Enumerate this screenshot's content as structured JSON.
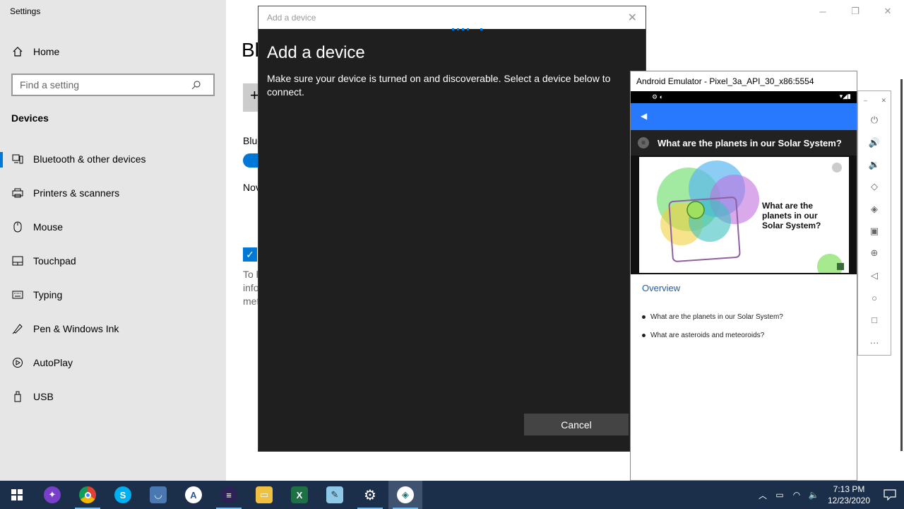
{
  "settings": {
    "window_title": "Settings",
    "home_label": "Home",
    "search_placeholder": "Find a setting",
    "section_header": "Devices",
    "nav": [
      {
        "label": "Bluetooth & other devices",
        "icon": "bluetooth-devices-icon"
      },
      {
        "label": "Printers & scanners",
        "icon": "printer-icon"
      },
      {
        "label": "Mouse",
        "icon": "mouse-icon"
      },
      {
        "label": "Touchpad",
        "icon": "touchpad-icon"
      },
      {
        "label": "Typing",
        "icon": "keyboard-icon"
      },
      {
        "label": "Pen & Windows Ink",
        "icon": "pen-icon"
      },
      {
        "label": "AutoPlay",
        "icon": "autoplay-icon"
      },
      {
        "label": "USB",
        "icon": "usb-icon"
      }
    ],
    "selected_index": 0,
    "background": {
      "page_title": "Bl",
      "add_symbol": "+",
      "bluetooth_label": "Blue",
      "now_label": "Nov",
      "para_lines": [
        "To h",
        "info",
        "met"
      ]
    }
  },
  "dialog": {
    "titlebar": "Add a device",
    "heading": "Add a device",
    "description": "Make sure your device is turned on and discoverable. Select a device below to connect.",
    "cancel_label": "Cancel"
  },
  "emulator": {
    "window_title": "Android Emulator - Pixel_3a_API_30_x86:5554",
    "content_title": "What are the planets in our Solar System?",
    "hero_text": "What are the planets in our Solar System?",
    "overview_label": "Overview",
    "bullets": [
      "What are the planets in our Solar System?",
      "What are asteroids and meteoroids?"
    ],
    "sidebar_buttons": [
      "power-icon",
      "volume-up-icon",
      "volume-down-icon",
      "rotate-left-icon",
      "rotate-right-icon",
      "camera-icon",
      "zoom-icon",
      "back-icon",
      "home-icon",
      "overview-icon",
      "more-icon"
    ]
  },
  "taskbar": {
    "apps": [
      "start",
      "app-purple",
      "chrome",
      "skype",
      "app-blue",
      "wordpad",
      "eclipse",
      "file-explorer",
      "excel",
      "notepad",
      "settings",
      "remote-app"
    ],
    "time": "7:13 PM",
    "date": "12/23/2020"
  },
  "colors": {
    "accent": "#0078d7",
    "taskbar": "#1b2f4a",
    "dialog_bg": "#1f1f1f",
    "app_bar": "#2979ff"
  }
}
